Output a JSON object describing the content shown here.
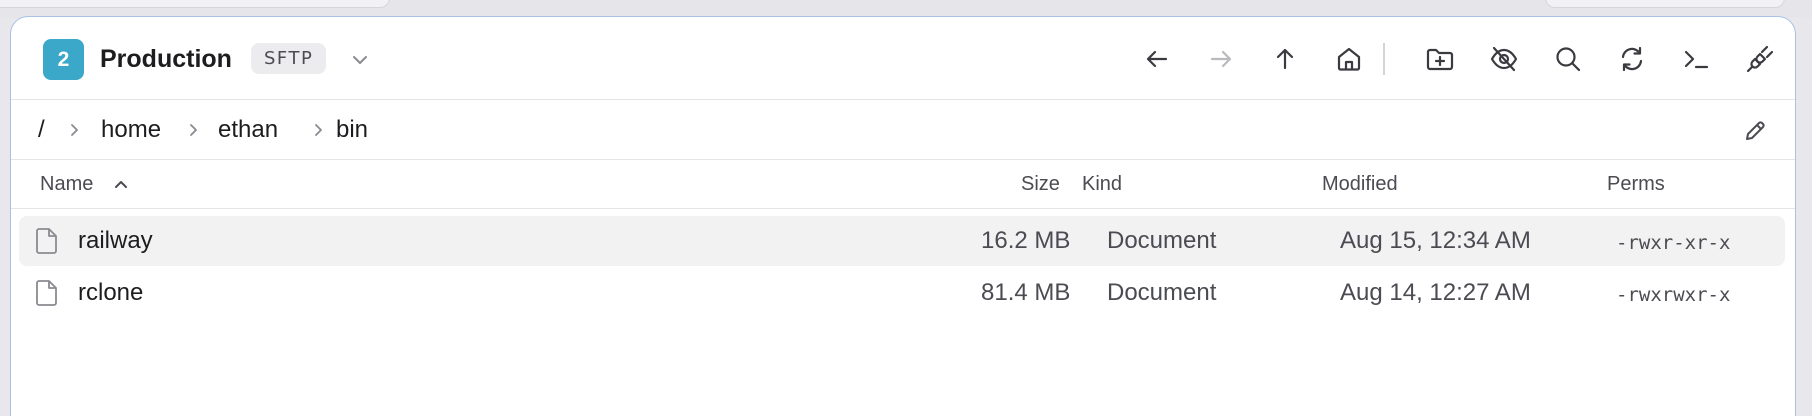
{
  "connection": {
    "index": "2",
    "name": "Production",
    "protocol": "SFTP",
    "accent_color": "#3ba7c9"
  },
  "toolbar": {
    "icons": [
      "arrow-left-icon",
      "arrow-right-icon",
      "arrow-up-icon",
      "home-icon",
      "new-folder-icon",
      "hidden-files-icon",
      "search-icon",
      "refresh-icon",
      "terminal-icon",
      "disconnect-icon"
    ]
  },
  "breadcrumb": {
    "root": "/",
    "items": [
      "home",
      "ethan",
      "bin"
    ]
  },
  "columns": {
    "name": "Name",
    "size": "Size",
    "kind": "Kind",
    "modified": "Modified",
    "perms": "Perms"
  },
  "files": [
    {
      "name": "railway",
      "size": "16.2 MB",
      "kind": "Document",
      "modified": "Aug 15, 12:34 AM",
      "perms": "-rwxr-xr-x",
      "selected": true
    },
    {
      "name": "rclone",
      "size": "81.4 MB",
      "kind": "Document",
      "modified": "Aug 14, 12:27 AM",
      "perms": "-rwxrwxr-x",
      "selected": false
    }
  ]
}
